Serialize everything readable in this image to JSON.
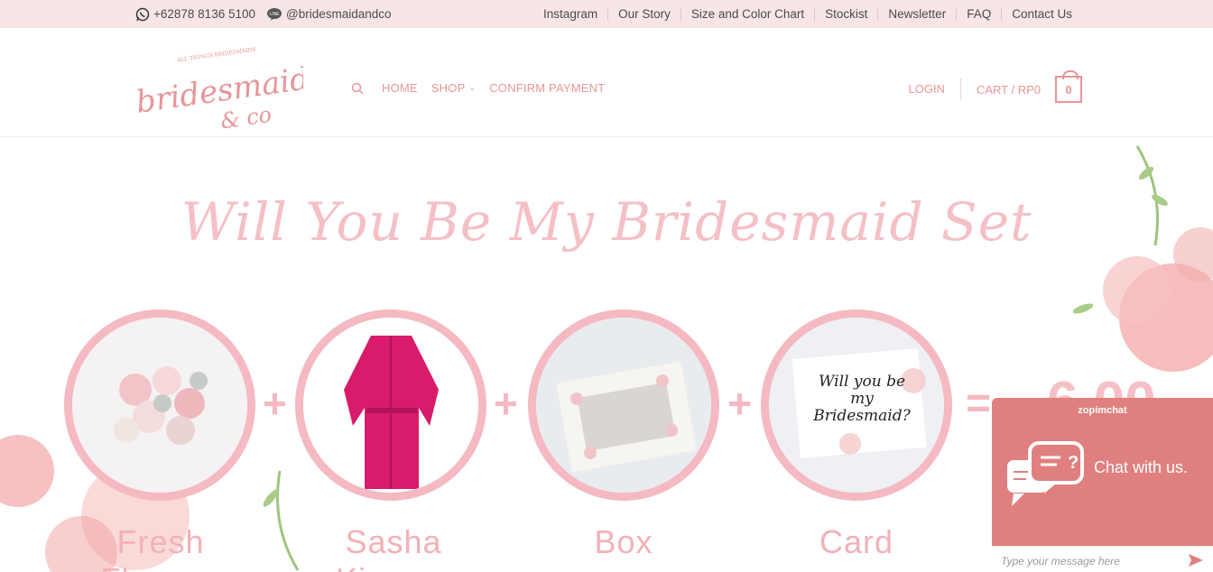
{
  "topbar": {
    "phone": "+62878 8136 5100",
    "line": "@bridesmaidandco",
    "links": [
      "Instagram",
      "Our Story",
      "Size and Color Chart",
      "Stockist",
      "Newsletter",
      "FAQ",
      "Contact Us"
    ]
  },
  "header": {
    "logo_top": "ALL THINGS BRIDESMAIDS",
    "logo_main": "bridesmaid",
    "logo_sub": "& co",
    "nav": {
      "home": "HOME",
      "shop": "SHOP",
      "confirm": "CONFIRM PAYMENT"
    },
    "login": "LOGIN",
    "cart": "CART / RP0",
    "cart_count": "0"
  },
  "hero": {
    "title": "Will You Be My Bridesmaid Set",
    "items": [
      {
        "label": "Fresh Flowers"
      },
      {
        "label": "Sasha Kimono"
      },
      {
        "label": "Box"
      },
      {
        "label": "Card"
      }
    ],
    "plus": "+",
    "equals": "=",
    "price_peek": "6.00",
    "card_text": "Will you be my Bridesmaid?"
  },
  "chat": {
    "brand": "zopimchat",
    "title": "Chat with us.",
    "placeholder": "Type your message here"
  },
  "colors": {
    "accent": "#e8959a",
    "topbar": "#f8e6e7",
    "chat": "#e07f7f"
  }
}
